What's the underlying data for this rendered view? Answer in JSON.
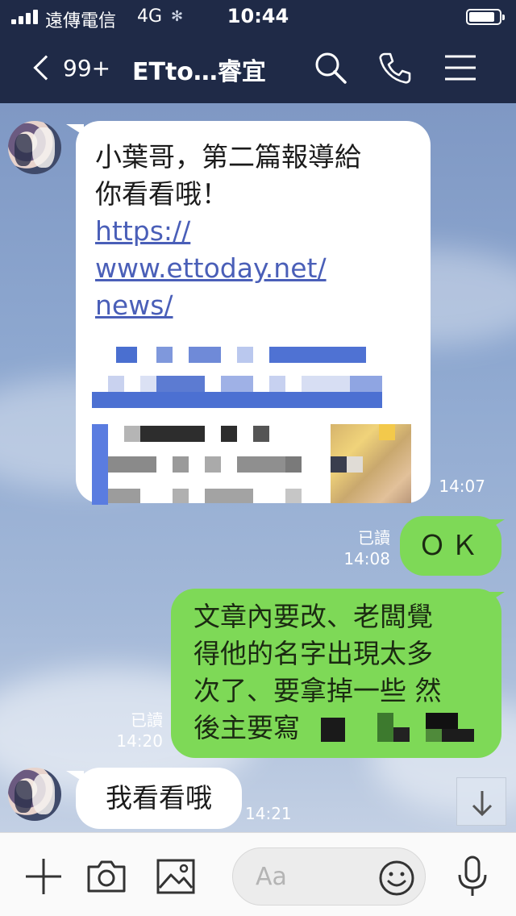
{
  "status_bar": {
    "carrier": "遠傳電信",
    "network": "4G",
    "time": "10:44",
    "battery_fraction": 0.85
  },
  "header": {
    "back_count": "99+",
    "title": "ETto…睿宜",
    "icons": [
      "search-icon",
      "phone-icon",
      "menu-icon"
    ]
  },
  "messages": [
    {
      "side": "in",
      "lines": [
        "小葉哥，第二篇報導給",
        "你看看哦！"
      ],
      "link_lines": [
        "https://",
        "www.ettoday.net/",
        "news/"
      ],
      "time": "14:07"
    },
    {
      "side": "out",
      "text": "ＯＫ",
      "read": "已讀",
      "time": "14:08"
    },
    {
      "side": "out",
      "lines": [
        "文章內要改、老闆覺",
        "得他的名字出現太多",
        "次了、要拿掉一些 然",
        "後主要寫"
      ],
      "read": "已讀",
      "time": "14:20"
    },
    {
      "side": "in",
      "text": "我看看哦",
      "time": "14:21"
    }
  ],
  "input": {
    "placeholder": "Aa",
    "icons": [
      "plus-icon",
      "camera-icon",
      "image-icon",
      "emoji-icon",
      "microphone-icon"
    ]
  },
  "colors": {
    "header_bg": "#1f2a47",
    "bubble_in": "#ffffff",
    "bubble_out": "#7ed957",
    "link": "#4a5fb8"
  }
}
